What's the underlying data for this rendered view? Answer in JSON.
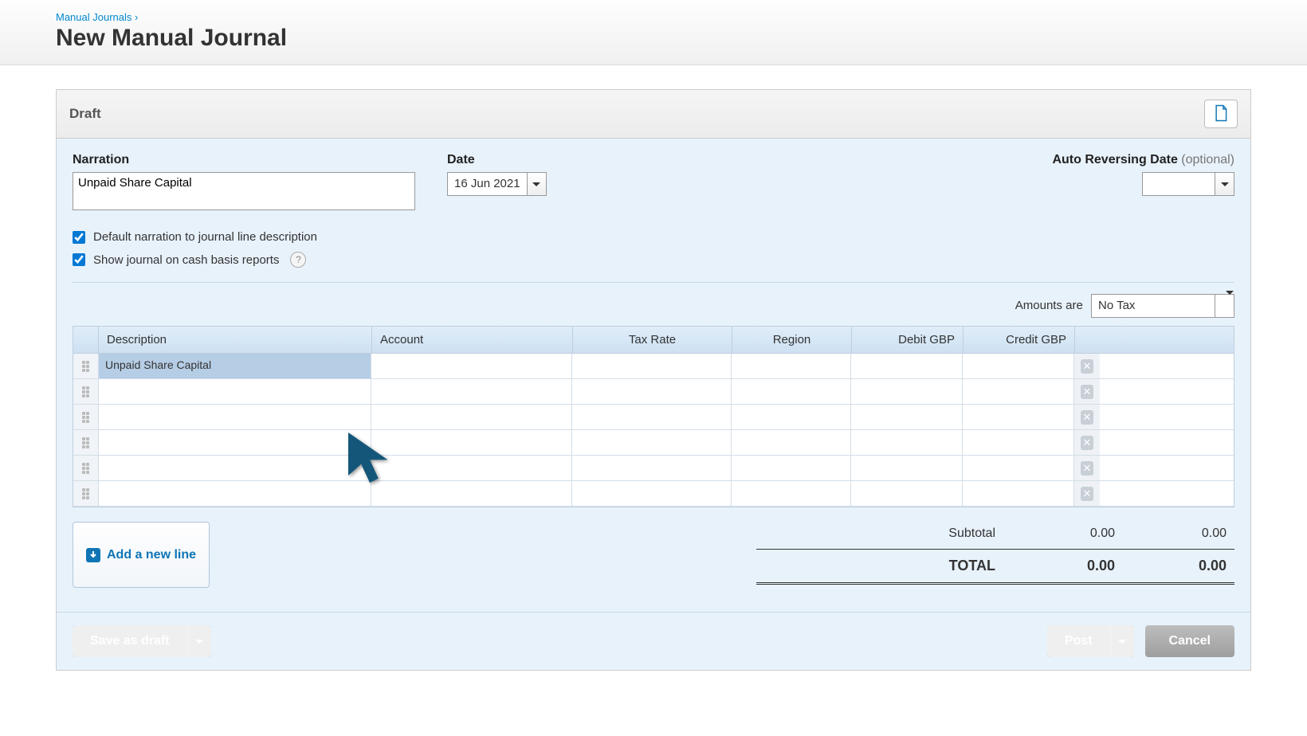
{
  "breadcrumb": {
    "parent": "Manual Journals",
    "sep": "›"
  },
  "page_title": "New Manual Journal",
  "panel": {
    "status": "Draft"
  },
  "form": {
    "narration_label": "Narration",
    "narration_value": "Unpaid Share Capital",
    "date_label": "Date",
    "date_value": "16 Jun 2021",
    "reversing_label": "Auto Reversing Date",
    "reversing_optional": "(optional)",
    "reversing_value": "",
    "check_default": "Default narration to journal line description",
    "check_cash": "Show journal on cash basis reports"
  },
  "amounts": {
    "label": "Amounts are",
    "value": "No Tax"
  },
  "columns": {
    "desc": "Description",
    "acct": "Account",
    "tax": "Tax Rate",
    "region": "Region",
    "debit": "Debit GBP",
    "credit": "Credit GBP"
  },
  "rows": [
    {
      "desc": "Unpaid Share Capital",
      "selected": true
    },
    {
      "desc": ""
    },
    {
      "desc": ""
    },
    {
      "desc": ""
    },
    {
      "desc": ""
    },
    {
      "desc": ""
    }
  ],
  "add_line": "Add a new line",
  "totals": {
    "subtotal_label": "Subtotal",
    "subtotal_debit": "0.00",
    "subtotal_credit": "0.00",
    "total_label": "TOTAL",
    "total_debit": "0.00",
    "total_credit": "0.00"
  },
  "footer": {
    "save": "Save as draft",
    "post": "Post",
    "cancel": "Cancel"
  }
}
